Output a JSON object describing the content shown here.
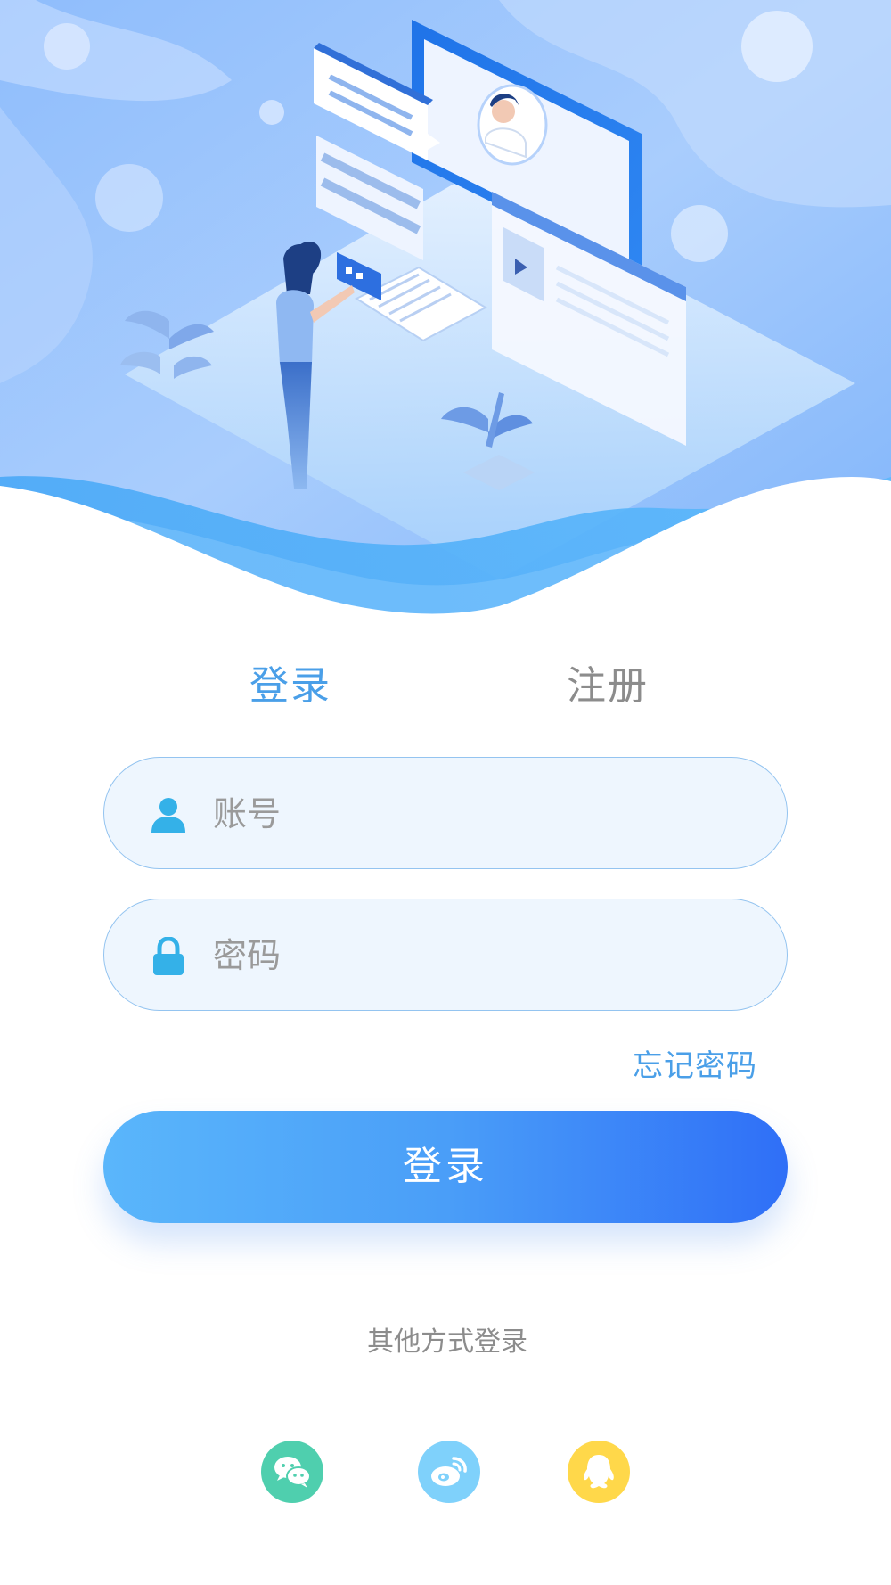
{
  "tabs": {
    "login_label": "登录",
    "register_label": "注册",
    "active": "login"
  },
  "form": {
    "account_placeholder": "账号",
    "password_placeholder": "密码",
    "account_icon": "user-icon",
    "password_icon": "lock-icon",
    "forgot_label": "忘记密码",
    "submit_label": "登录"
  },
  "other_login": {
    "label": "其他方式登录",
    "providers": [
      {
        "name": "wechat",
        "icon": "wechat-icon",
        "color": "#4fcfae"
      },
      {
        "name": "weibo",
        "icon": "weibo-icon",
        "color": "#7fd1fb"
      },
      {
        "name": "qq",
        "icon": "qq-icon",
        "color": "#ffd84a"
      }
    ]
  },
  "colors": {
    "accent": "#4a9fe8",
    "button_gradient_start": "#5ab6fb",
    "button_gradient_end": "#2f6ff7",
    "field_background": "#eef6fe",
    "field_border": "#94c4f0",
    "inactive_tab": "#8c8c8c"
  }
}
